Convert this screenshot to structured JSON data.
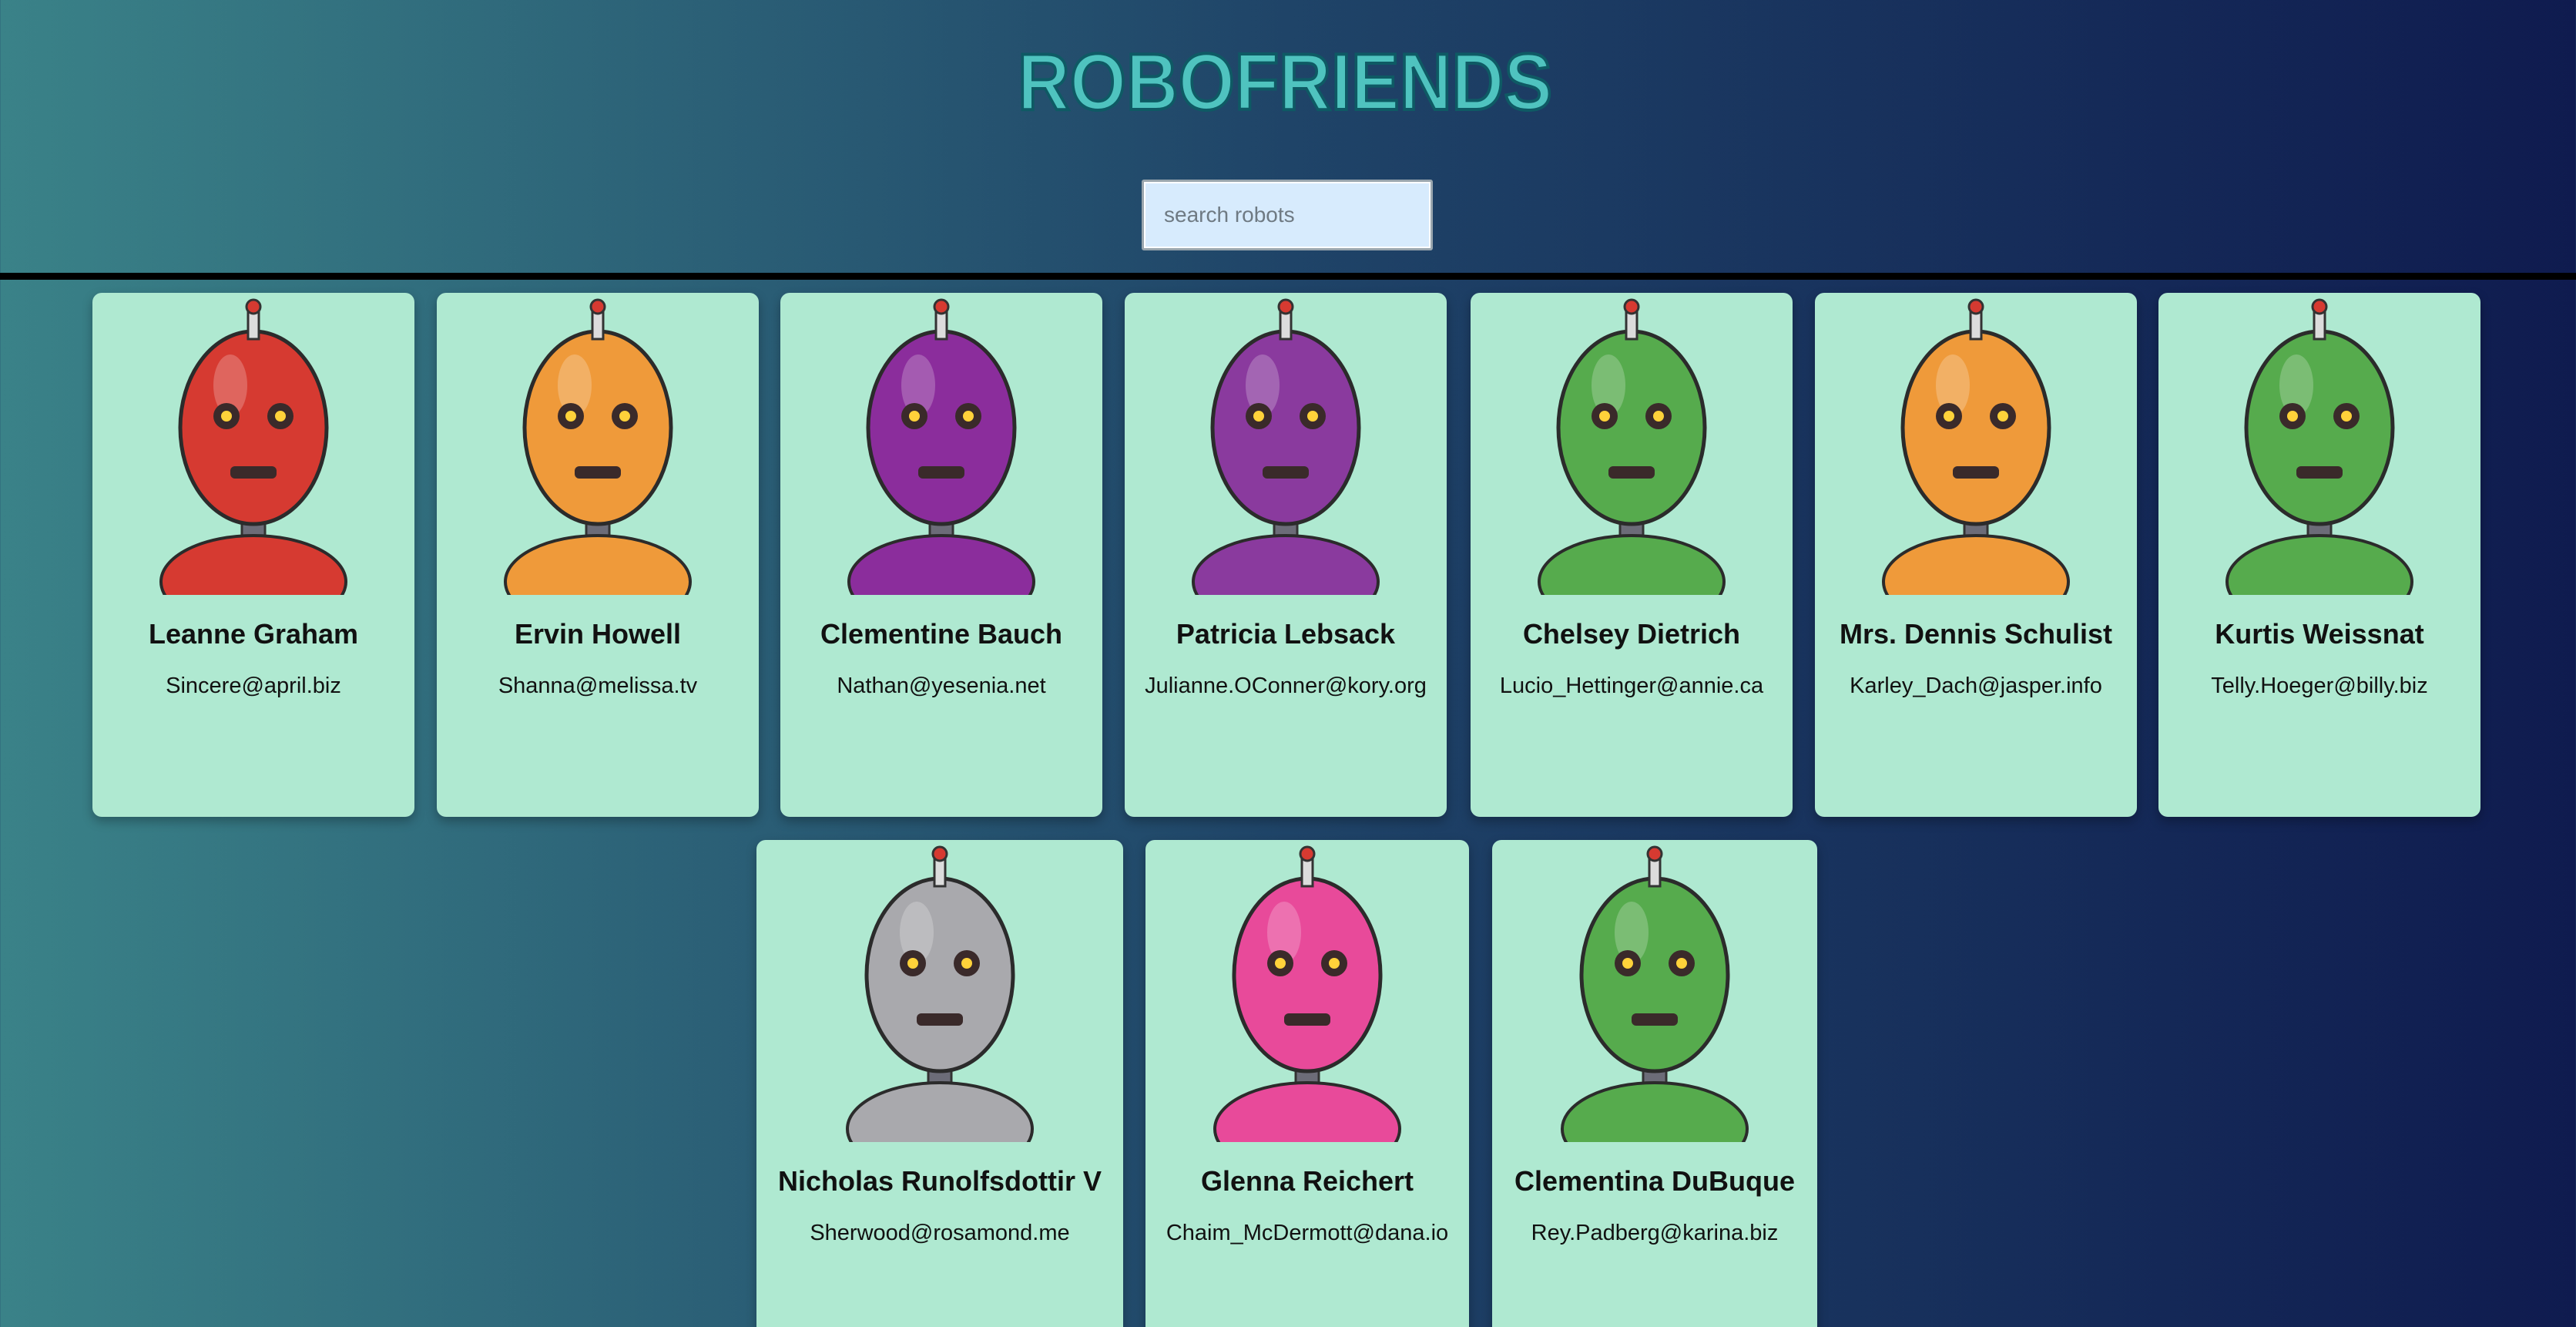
{
  "app": {
    "title": "ROBOFRIENDS"
  },
  "search": {
    "placeholder": "search robots",
    "value": ""
  },
  "robots": [
    {
      "name": "Leanne Graham",
      "email": "Sincere@april.biz",
      "color": "#d63a31"
    },
    {
      "name": "Ervin Howell",
      "email": "Shanna@melissa.tv",
      "color": "#ef9a3a"
    },
    {
      "name": "Clementine Bauch",
      "email": "Nathan@yesenia.net",
      "color": "#8b2d9c"
    },
    {
      "name": "Patricia Lebsack",
      "email": "Julianne.OConner@kory.org",
      "color": "#8a3a9e"
    },
    {
      "name": "Chelsey Dietrich",
      "email": "Lucio_Hettinger@annie.ca",
      "color": "#56ab4d"
    },
    {
      "name": "Mrs. Dennis Schulist",
      "email": "Karley_Dach@jasper.info",
      "color": "#ef9a3a"
    },
    {
      "name": "Kurtis Weissnat",
      "email": "Telly.Hoeger@billy.biz",
      "color": "#56ab4d"
    },
    {
      "name": "Nicholas Runolfsdottir V",
      "email": "Sherwood@rosamond.me",
      "color": "#a9a9ad"
    },
    {
      "name": "Glenna Reichert",
      "email": "Chaim_McDermott@dana.io",
      "color": "#e84a9a"
    },
    {
      "name": "Clementina DuBuque",
      "email": "Rey.Padberg@karina.biz",
      "color": "#56ab4d"
    }
  ]
}
